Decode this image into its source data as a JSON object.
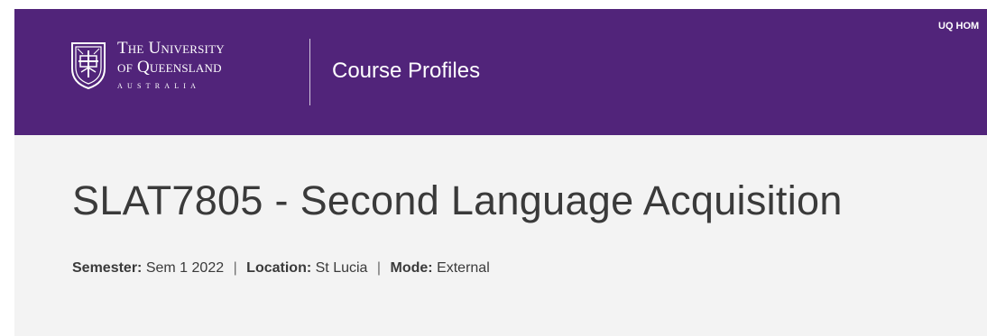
{
  "header": {
    "university_line1": "The University",
    "university_line2": "of Queensland",
    "university_line3": "AUSTRALIA",
    "site_title": "Course Profiles",
    "home_link": "UQ HOM"
  },
  "course": {
    "title": "SLAT7805 - Second Language Acquisition",
    "semester_label": "Semester:",
    "semester_value": "Sem 1 2022",
    "location_label": "Location:",
    "location_value": "St Lucia",
    "mode_label": "Mode:",
    "mode_value": "External",
    "separator": "|"
  },
  "colors": {
    "brand_purple": "#51247a",
    "banner_grey": "#f3f3f3",
    "text_dark": "#3a3a3a"
  },
  "icons": {
    "logo": "uq-crest-icon"
  }
}
